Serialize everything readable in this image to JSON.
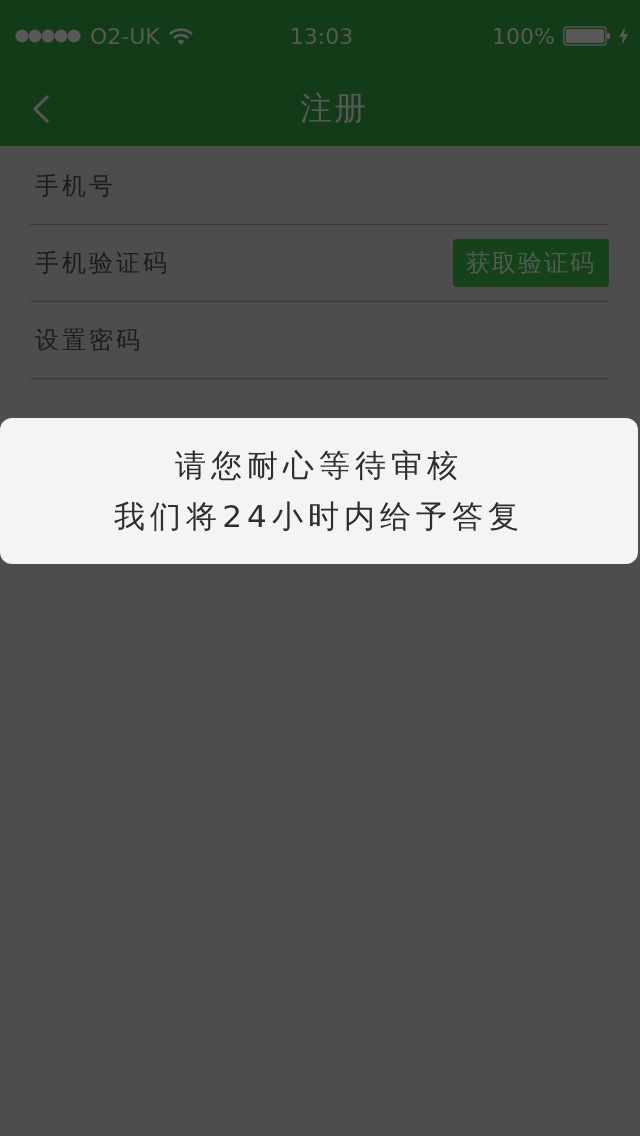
{
  "status_bar": {
    "carrier": "O2-UK",
    "time": "13:03",
    "battery": "100%"
  },
  "nav_bar": {
    "title": "注册"
  },
  "form": {
    "fields": [
      {
        "placeholder": "手机号"
      },
      {
        "placeholder": "手机验证码",
        "button": "获取验证码"
      },
      {
        "placeholder": "设置密码"
      }
    ]
  },
  "dialog": {
    "lines": [
      "请您耐心等待审核",
      "我们将24小时内给予答复"
    ]
  }
}
